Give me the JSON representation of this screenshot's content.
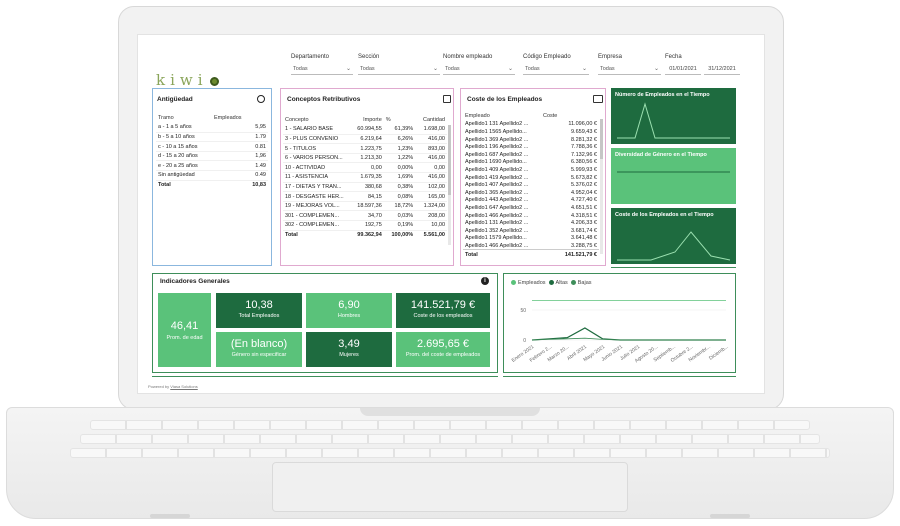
{
  "brand": {
    "logo_text": "kiwi",
    "footer": "Powered by",
    "footer_link": "Viasa Solutions"
  },
  "filters": [
    {
      "label": "Departamento",
      "value": "Todas"
    },
    {
      "label": "Sección",
      "value": "Todas"
    },
    {
      "label": "Nombre empleado",
      "value": "Todas"
    },
    {
      "label": "Código Empleado",
      "value": "Todas"
    },
    {
      "label": "Empresa",
      "value": "Todas"
    }
  ],
  "date_filter": {
    "label": "Fecha",
    "from": "01/01/2021",
    "to": "31/12/2021"
  },
  "antiguedad": {
    "title": "Antigüedad",
    "headers": [
      "Tramo",
      "Empleados"
    ],
    "rows": [
      [
        "a - 1 a 5 años",
        "5,95"
      ],
      [
        "b - 5 a 10 años",
        "1.79"
      ],
      [
        "c - 10 a 15 años",
        "0.81"
      ],
      [
        "d - 15 a 20 años",
        "1,96"
      ],
      [
        "e - 20 a 25 años",
        "1.49"
      ],
      [
        "Sin antigüedad",
        "0.49"
      ]
    ],
    "total_label": "Total",
    "total_value": "10,83"
  },
  "conceptos": {
    "title": "Conceptos Retributivos",
    "headers": [
      "Concepto",
      "Importe",
      "%",
      "Cantidad"
    ],
    "rows": [
      [
        "1 - SALARIO BASE",
        "60.994,55",
        "61,39%",
        "1.698,00"
      ],
      [
        "3 - PLUS CONVENIO",
        "6.219,64",
        "6,26%",
        "416,00"
      ],
      [
        "5 - TITULOS",
        "1.223,75",
        "1,23%",
        "893,00"
      ],
      [
        "6 - VARIOS PERSON...",
        "1.213,30",
        "1,22%",
        "416,00"
      ],
      [
        "10 - ACTIVIDAD",
        "0,00",
        "0,00%",
        "0,00"
      ],
      [
        "11 - ASISTENCIA",
        "1.679,35",
        "1,69%",
        "416,00"
      ],
      [
        "17 - DIETAS Y TRAN...",
        "380,68",
        "0,38%",
        "102,00"
      ],
      [
        "18 - DESGASTE HER...",
        "84,15",
        "0,08%",
        "165,00"
      ],
      [
        "19 - MEJORAS VOL...",
        "18.597,36",
        "18,72%",
        "1.324,00"
      ],
      [
        "301 - COMPLEMEN...",
        "34,70",
        "0,03%",
        "208,00"
      ],
      [
        "302 - COMPLEMEN...",
        "192,75",
        "0,19%",
        "10,00"
      ]
    ],
    "total": [
      "Total",
      "99.362,94",
      "100,00%",
      "5.561,00"
    ]
  },
  "coste": {
    "title": "Coste de los Empleados",
    "headers": [
      "Empleado",
      "Coste"
    ],
    "rows": [
      [
        "Apellido1 131 Apellido2 ...",
        "11.096,00 €"
      ],
      [
        "Apellido1 1565 Apellido...",
        "9.659,43 €"
      ],
      [
        "Apellido1 369 Apellido2 ...",
        "8.281,32 €"
      ],
      [
        "Apellido1 196 Apellido2 ...",
        "7.788,36 €"
      ],
      [
        "Apellido1 687 Apellido2 ...",
        "7.132,96 €"
      ],
      [
        "Apellido1 1690 Apellido...",
        "6.380,56 €"
      ],
      [
        "Apellido1 409 Apellido2 ...",
        "5.999,93 €"
      ],
      [
        "Apellido1 419 Apellido2 ...",
        "5.673,82 €"
      ],
      [
        "Apellido1 407 Apellido2 ...",
        "5.376,02 €"
      ],
      [
        "Apellido1 365 Apellido2 ...",
        "4.952,04 €"
      ],
      [
        "Apellido1 443 Apellido2 ...",
        "4.727,40 €"
      ],
      [
        "Apellido1 647 Apellido2 ...",
        "4.651,51 €"
      ],
      [
        "Apellido1 466 Apellido2 ...",
        "4.318,51 €"
      ],
      [
        "Apellido1 131 Apellido2 ...",
        "4.206,33 €"
      ],
      [
        "Apellido1 352 Apellido2 ...",
        "3.681,74 €"
      ],
      [
        "Apellido1 1579 Apellido...",
        "3.641,48 €"
      ],
      [
        "Apellido1 466 Apellido2 ...",
        "3.288,75 €"
      ]
    ],
    "total": [
      "Total",
      "141.521,79 €"
    ]
  },
  "tiles": [
    {
      "title": "Número de Empleados en el Tiempo",
      "color": "#1e6b3f"
    },
    {
      "title": "Diversidad de Género en el Tiempo",
      "color": "#5ac27a"
    },
    {
      "title": "Coste de los Empleados en el Tiempo",
      "color": "#1e6b3f"
    }
  ],
  "indicadores": {
    "title": "Indicadores Generales",
    "edad": {
      "value": "46,41",
      "label": "Prom. de edad"
    },
    "kpis": [
      {
        "value": "10,38",
        "label": "Total Empleados",
        "style": "dark"
      },
      {
        "value": "6,90",
        "label": "Hombres",
        "style": "light"
      },
      {
        "value": "141.521,79 €",
        "label": "Coste de los empleados",
        "style": "dark"
      },
      {
        "value": "(En blanco)",
        "label": "Género sin especificar",
        "style": "light"
      },
      {
        "value": "3,49",
        "label": "Mujeres",
        "style": "dark"
      },
      {
        "value": "2.695,65 €",
        "label": "Prom. del coste de empleados",
        "style": "light"
      }
    ]
  },
  "chart_data": {
    "type": "line",
    "legend": [
      {
        "name": "Empleados",
        "color": "#5ac27a"
      },
      {
        "name": "Altas",
        "color": "#1e6b3f"
      },
      {
        "name": "Bajas",
        "color": "#3e8e5a"
      }
    ],
    "legend_placement": "top-left",
    "categories": [
      "Enero 2021",
      "Febrero 2...",
      "Marzo 20...",
      "Abril 2021",
      "Mayo 2021",
      "Junio 2021",
      "Julio 2021",
      "Agosto 20...",
      "Septiemb...",
      "Octubre 2...",
      "Noviembr...",
      "Diciemb..."
    ],
    "yticks": [
      "0",
      "50"
    ],
    "ylim": [
      0,
      80
    ],
    "series": [
      {
        "name": "Empleados",
        "values": [
          66,
          66,
          66,
          66,
          66,
          66,
          66,
          66,
          66,
          66,
          66,
          66
        ]
      },
      {
        "name": "Altas",
        "values": [
          0,
          2,
          4,
          20,
          2,
          0,
          0,
          0,
          0,
          0,
          0,
          0
        ]
      },
      {
        "name": "Bajas",
        "values": [
          0,
          1,
          2,
          3,
          1,
          0,
          0,
          0,
          0,
          0,
          0,
          0
        ]
      }
    ]
  }
}
